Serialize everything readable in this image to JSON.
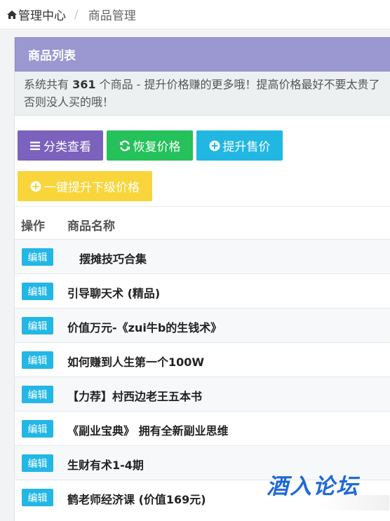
{
  "breadcrumb": {
    "home_label": "管理中心",
    "separator": "/",
    "current": "商品管理"
  },
  "panel": {
    "title": "商品列表",
    "notice": {
      "prefix": "系统共有 ",
      "count": "361",
      "suffix": " 个商品 - 提升价格赚的更多哦！提高价格最好不要太贵了否则没人买的哦！"
    }
  },
  "buttons": {
    "category": "分类查看",
    "restore": "恢复价格",
    "raise": "提升售价",
    "raise_sub": "一键提升下级价格"
  },
  "colors": {
    "purple": "#7b62bd",
    "green": "#25c15a",
    "cyan": "#22b7e3",
    "yellow": "#f8d53a",
    "heading": "#9b97d1"
  },
  "table": {
    "headers": {
      "op": "操作",
      "name": "商品名称"
    },
    "edit_label": "编辑",
    "rows": [
      {
        "name": "摆摊技巧合集"
      },
      {
        "name": "引导聊天术 (精品)"
      },
      {
        "name": "价值万元-《zui牛b的生钱术》"
      },
      {
        "name": "如何赚到人生第一个100W"
      },
      {
        "name": "【力荐】村西边老王五本书"
      },
      {
        "name": "《副业宝典》 拥有全新副业思维"
      },
      {
        "name": "生财有术1-4期"
      },
      {
        "name": "鹤老师经济课 (价值169元)"
      }
    ]
  },
  "watermark": "酒入论坛"
}
